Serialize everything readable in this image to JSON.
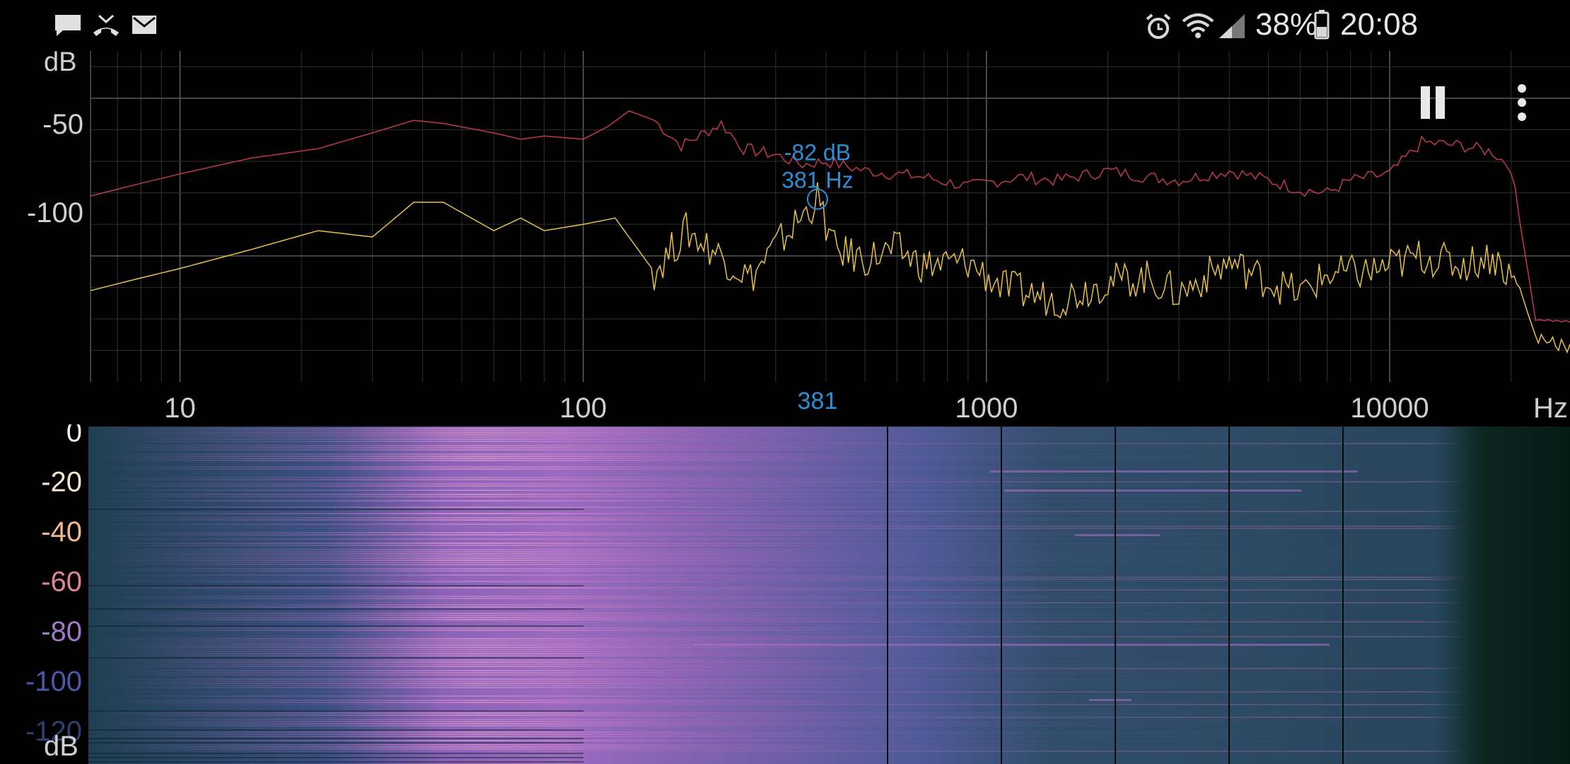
{
  "status_bar": {
    "left_icons": [
      "message-icon",
      "missed-call-icon",
      "email-icon"
    ],
    "right_icons": [
      "alarm-icon",
      "wifi-icon",
      "signal-icon",
      "battery-icon"
    ],
    "battery_percent": "38%",
    "time": "20:08"
  },
  "toolbar": {
    "pause_icon": "pause-icon",
    "menu_icon": "more-vert-icon"
  },
  "spectrum": {
    "unit_y": "dB",
    "unit_x": "Hz",
    "y_ticks": [
      "-50",
      "-100"
    ],
    "x_ticks": [
      "10",
      "100",
      "1000",
      "10000"
    ],
    "cursor": {
      "db_label": "-82 dB",
      "hz_label": "381 Hz",
      "axis_label": "381",
      "freq": 381,
      "db": -82
    },
    "colors": {
      "peak_line": "#c0394f",
      "live_line": "#e8c048",
      "cursor": "#2a8fd6",
      "grid": "#3a3a3a"
    }
  },
  "spectrogram": {
    "unit": "dB",
    "ticks": [
      {
        "label": "0",
        "color": "#f2f2f2"
      },
      {
        "label": "-20",
        "color": "#f4e6cf"
      },
      {
        "label": "-40",
        "color": "#f0b98a"
      },
      {
        "label": "-60",
        "color": "#e0839a"
      },
      {
        "label": "-80",
        "color": "#a27ac9"
      },
      {
        "label": "-100",
        "color": "#4a5aa8"
      },
      {
        "label": "-120",
        "color": "#2c3f6f"
      }
    ]
  },
  "chart_data": {
    "type": "line",
    "xscale": "log",
    "xlim": [
      6,
      28000
    ],
    "ylim": [
      -140,
      -35
    ],
    "xlabel": "Hz",
    "ylabel": "dB",
    "series": [
      {
        "color": "#c0394f",
        "points": [
          [
            6,
            -81
          ],
          [
            8,
            -77
          ],
          [
            10,
            -74
          ],
          [
            15,
            -69
          ],
          [
            22,
            -66
          ],
          [
            30,
            -61
          ],
          [
            38,
            -57
          ],
          [
            45,
            -58
          ],
          [
            60,
            -61
          ],
          [
            70,
            -63
          ],
          [
            80,
            -62
          ],
          [
            100,
            -63
          ],
          [
            115,
            -59
          ],
          [
            130,
            -54
          ],
          [
            150,
            -57
          ],
          [
            175,
            -65
          ],
          [
            200,
            -61
          ],
          [
            220,
            -58
          ],
          [
            250,
            -66
          ],
          [
            300,
            -68
          ],
          [
            350,
            -71
          ],
          [
            400,
            -70
          ],
          [
            500,
            -73
          ],
          [
            700,
            -75
          ],
          [
            900,
            -78
          ],
          [
            1200,
            -75
          ],
          [
            1500,
            -76
          ],
          [
            2000,
            -73
          ],
          [
            2500,
            -75
          ],
          [
            3000,
            -76
          ],
          [
            4000,
            -73
          ],
          [
            5000,
            -76
          ],
          [
            6000,
            -79
          ],
          [
            7000,
            -80
          ],
          [
            8000,
            -76
          ],
          [
            10000,
            -74
          ],
          [
            12000,
            -64
          ],
          [
            15000,
            -65
          ],
          [
            18000,
            -67
          ],
          [
            20000,
            -72
          ],
          [
            23000,
            -120
          ],
          [
            28000,
            -121
          ]
        ]
      },
      {
        "color": "#e8c048",
        "points": [
          [
            6,
            -111
          ],
          [
            8,
            -107
          ],
          [
            10,
            -104
          ],
          [
            15,
            -98
          ],
          [
            22,
            -92
          ],
          [
            30,
            -94
          ],
          [
            38,
            -83
          ],
          [
            45,
            -83
          ],
          [
            60,
            -92
          ],
          [
            70,
            -88
          ],
          [
            80,
            -92
          ],
          [
            100,
            -90
          ],
          [
            120,
            -88
          ],
          [
            150,
            -105
          ],
          [
            180,
            -92
          ],
          [
            220,
            -100
          ],
          [
            260,
            -107
          ],
          [
            300,
            -97
          ],
          [
            381,
            -82
          ],
          [
            420,
            -98
          ],
          [
            500,
            -101
          ],
          [
            600,
            -98
          ],
          [
            700,
            -103
          ],
          [
            900,
            -102
          ],
          [
            1100,
            -110
          ],
          [
            1500,
            -114
          ],
          [
            2000,
            -108
          ],
          [
            2500,
            -107
          ],
          [
            3000,
            -112
          ],
          [
            4000,
            -102
          ],
          [
            5000,
            -108
          ],
          [
            6000,
            -112
          ],
          [
            7000,
            -106
          ],
          [
            9000,
            -105
          ],
          [
            12000,
            -100
          ],
          [
            15000,
            -103
          ],
          [
            18000,
            -100
          ],
          [
            21000,
            -110
          ],
          [
            23000,
            -126
          ],
          [
            28000,
            -128
          ]
        ]
      }
    ]
  }
}
